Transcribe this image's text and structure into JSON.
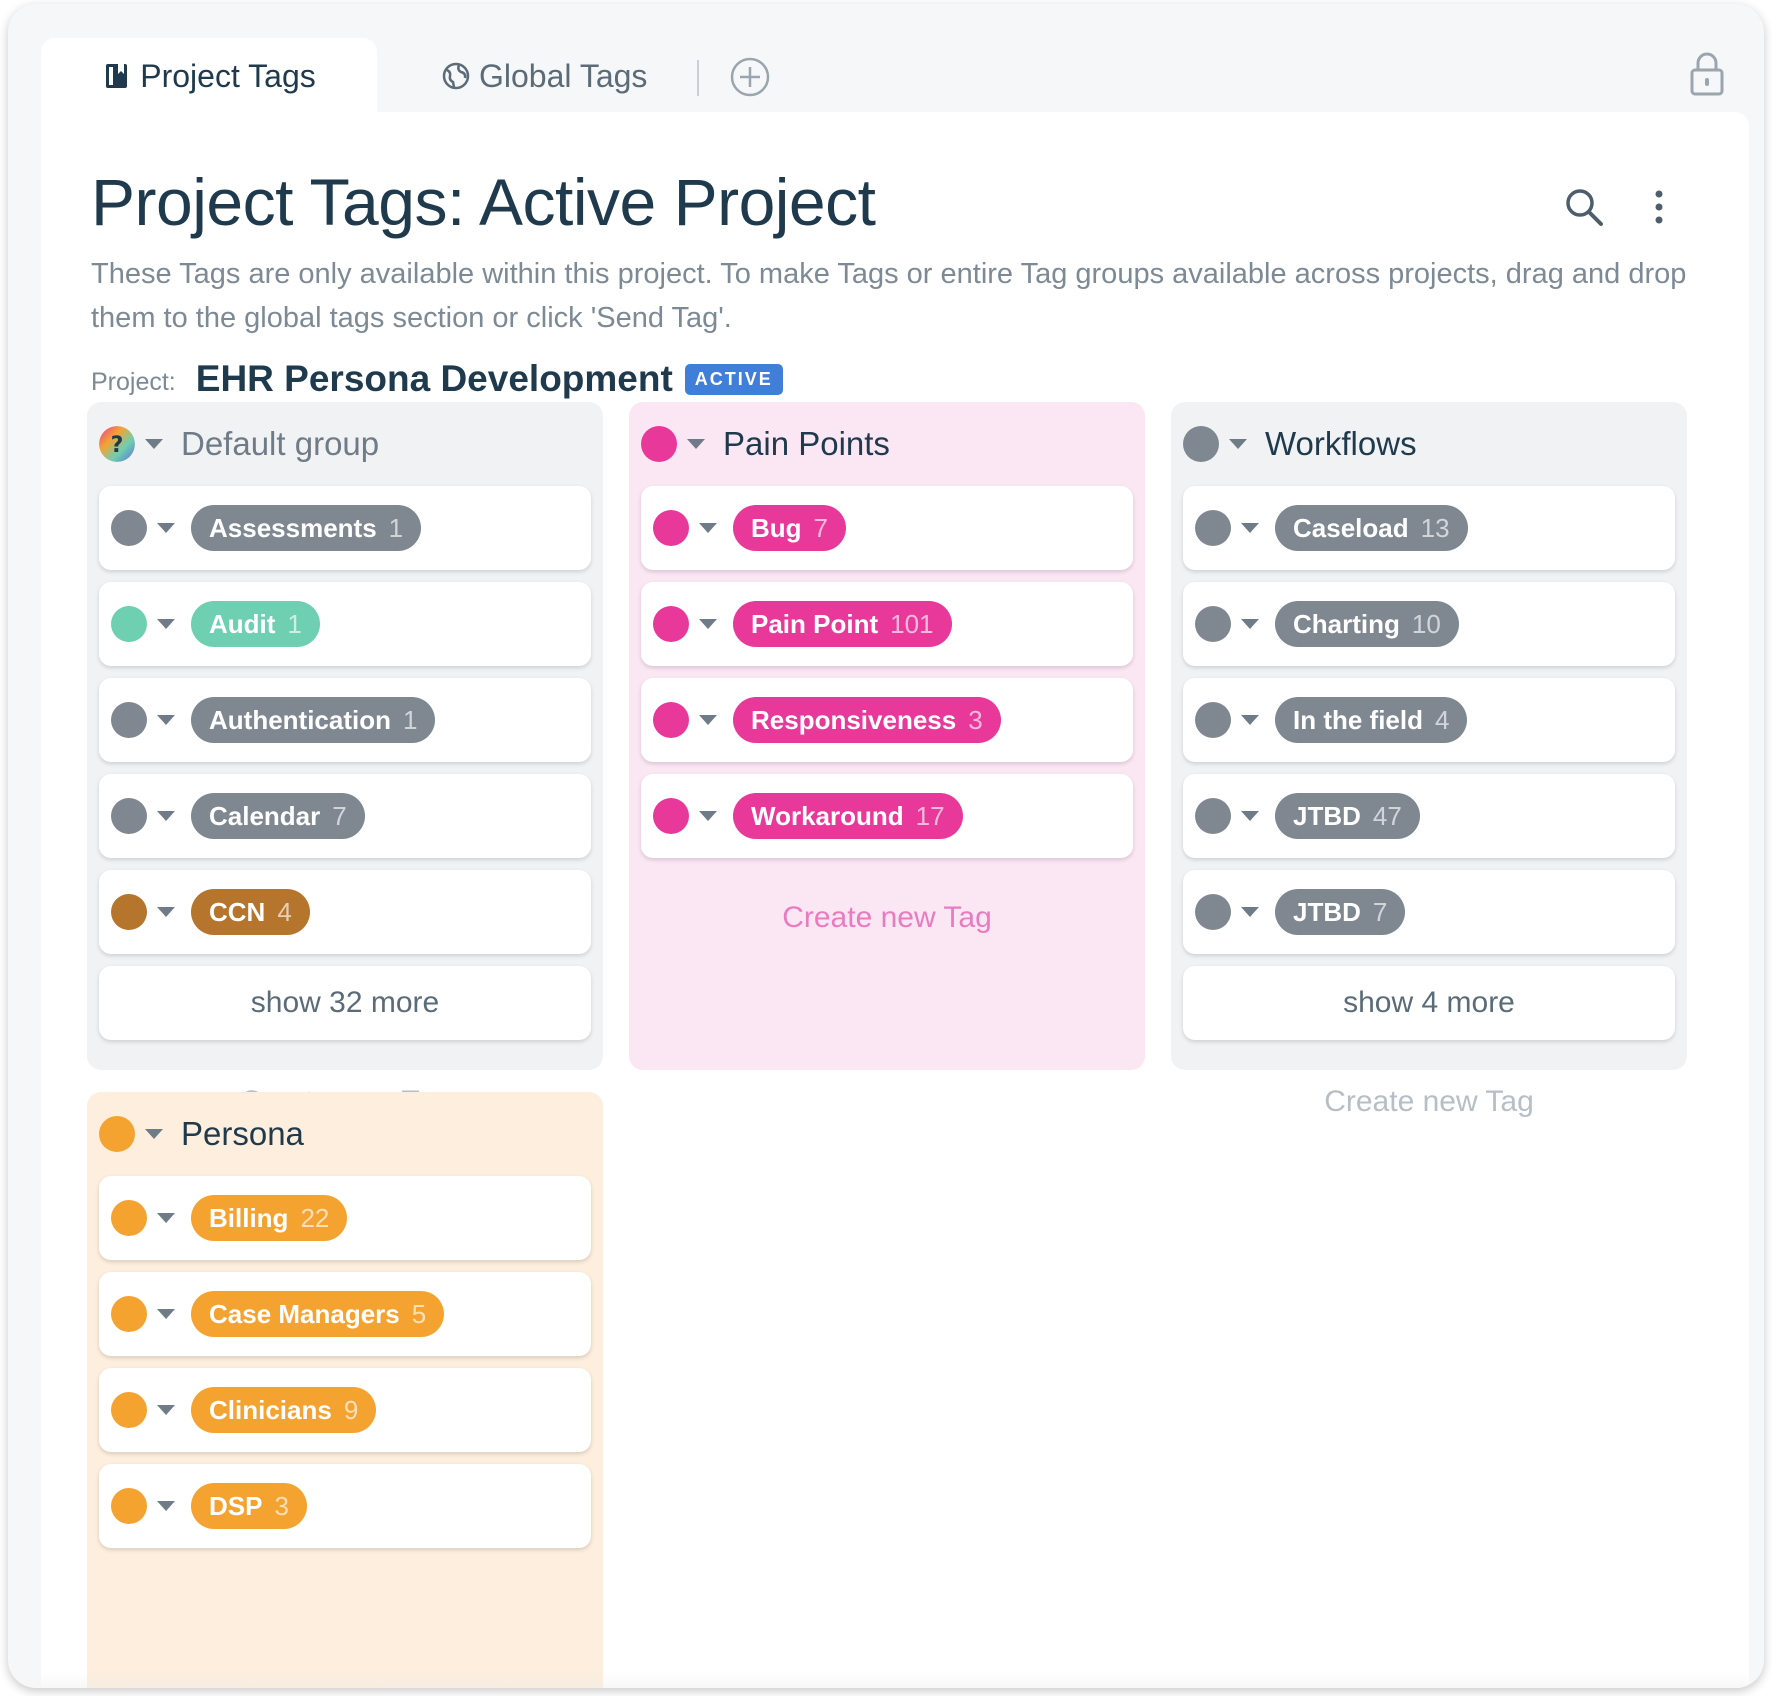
{
  "tabs": {
    "project": "Project Tags",
    "global": "Global Tags"
  },
  "header": {
    "title": "Project Tags: Active Project",
    "description": "These Tags are only available within this project. To make Tags or entire Tag groups available across projects, drag and drop them to the global tags section or click 'Send Tag'.",
    "project_label": "Project:",
    "project_name": "EHR Persona Development",
    "project_status": "ACTIVE"
  },
  "colors": {
    "gray": "#7f8891",
    "teal": "#6fcfb1",
    "brown": "#b5752c",
    "pink": "#e8399a",
    "orange": "#f4a331",
    "active_badge": "#3f7fd9"
  },
  "groups": {
    "default": {
      "title": "Default group",
      "tags": [
        {
          "name": "Assessments",
          "count": "1"
        },
        {
          "name": "Audit",
          "count": "1"
        },
        {
          "name": "Authentication",
          "count": "1"
        },
        {
          "name": "Calendar",
          "count": "7"
        },
        {
          "name": "CCN",
          "count": "4"
        }
      ],
      "show_more": "show 32 more",
      "create": "Create new Tag"
    },
    "pain": {
      "title": "Pain Points",
      "tags": [
        {
          "name": "Bug",
          "count": "7"
        },
        {
          "name": "Pain Point",
          "count": "101"
        },
        {
          "name": "Responsiveness",
          "count": "3"
        },
        {
          "name": "Workaround",
          "count": "17"
        }
      ],
      "create": "Create new Tag"
    },
    "workflows": {
      "title": "Workflows",
      "tags": [
        {
          "name": "Caseload",
          "count": "13"
        },
        {
          "name": "Charting",
          "count": "10"
        },
        {
          "name": "In the field",
          "count": "4"
        },
        {
          "name": "JTBD",
          "count": "47"
        },
        {
          "name": "JTBD",
          "count": "7"
        }
      ],
      "show_more": "show 4 more",
      "create": "Create new Tag"
    },
    "persona": {
      "title": "Persona",
      "tags": [
        {
          "name": "Billing",
          "count": "22"
        },
        {
          "name": "Case Managers",
          "count": "5"
        },
        {
          "name": "Clinicians",
          "count": "9"
        },
        {
          "name": "DSP",
          "count": "3"
        }
      ]
    }
  }
}
